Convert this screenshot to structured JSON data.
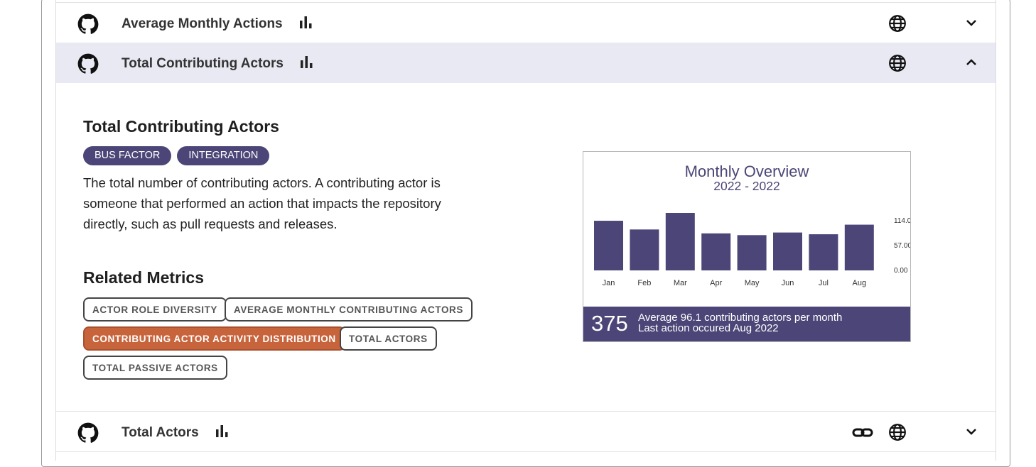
{
  "rows": [
    {
      "title": "Average Monthly Actions",
      "expanded": false,
      "icons": [
        "github-icon",
        "bar-chart-icon",
        "globe-icon",
        "chevron-down-icon"
      ]
    },
    {
      "title": "Total Contributing Actors",
      "expanded": true,
      "icons": [
        "github-icon",
        "bar-chart-icon",
        "globe-icon",
        "chevron-up-icon"
      ]
    },
    {
      "title": "Total Actors",
      "expanded": false,
      "icons": [
        "github-icon",
        "bar-chart-icon",
        "link-icon",
        "globe-icon",
        "chevron-down-icon"
      ]
    }
  ],
  "detail": {
    "title": "Total Contributing Actors",
    "tags": [
      "BUS FACTOR",
      "INTEGRATION"
    ],
    "description": "The total number of contributing actors. A contributing actor is someone that performed an action that impacts the repository directly, such as pull requests and releases.",
    "related_title": "Related Metrics",
    "related": [
      {
        "label": "ACTOR ROLE DIVERSITY",
        "active": false
      },
      {
        "label": "AVERAGE MONTHLY CONTRIBUTING ACTORS",
        "active": false
      },
      {
        "label": "CONTRIBUTING ACTOR ACTIVITY DISTRIBUTION",
        "active": true
      },
      {
        "label": "TOTAL ACTORS",
        "active": false
      },
      {
        "label": "TOTAL PASSIVE ACTORS",
        "active": false
      }
    ]
  },
  "colors": {
    "accent": "#4b4677",
    "active_chip": "#c8643c",
    "expanded_row_bg": "#e8e9f3"
  },
  "chart_data": {
    "type": "bar",
    "title": "Monthly Overview",
    "subtitle": "2022 - 2022",
    "categories": [
      "Jan",
      "Feb",
      "Mar",
      "Apr",
      "May",
      "Jun",
      "Jul",
      "Aug"
    ],
    "values": [
      114,
      94,
      132,
      85,
      81,
      87,
      83,
      105
    ],
    "y_ticks": [
      "114.00",
      "57.00",
      "0.00"
    ],
    "ylim": [
      0,
      132
    ],
    "summary_number": "375",
    "summary_line1": "Average 96.1 contributing actors per month",
    "summary_line2": "Last action occured Aug 2022"
  }
}
